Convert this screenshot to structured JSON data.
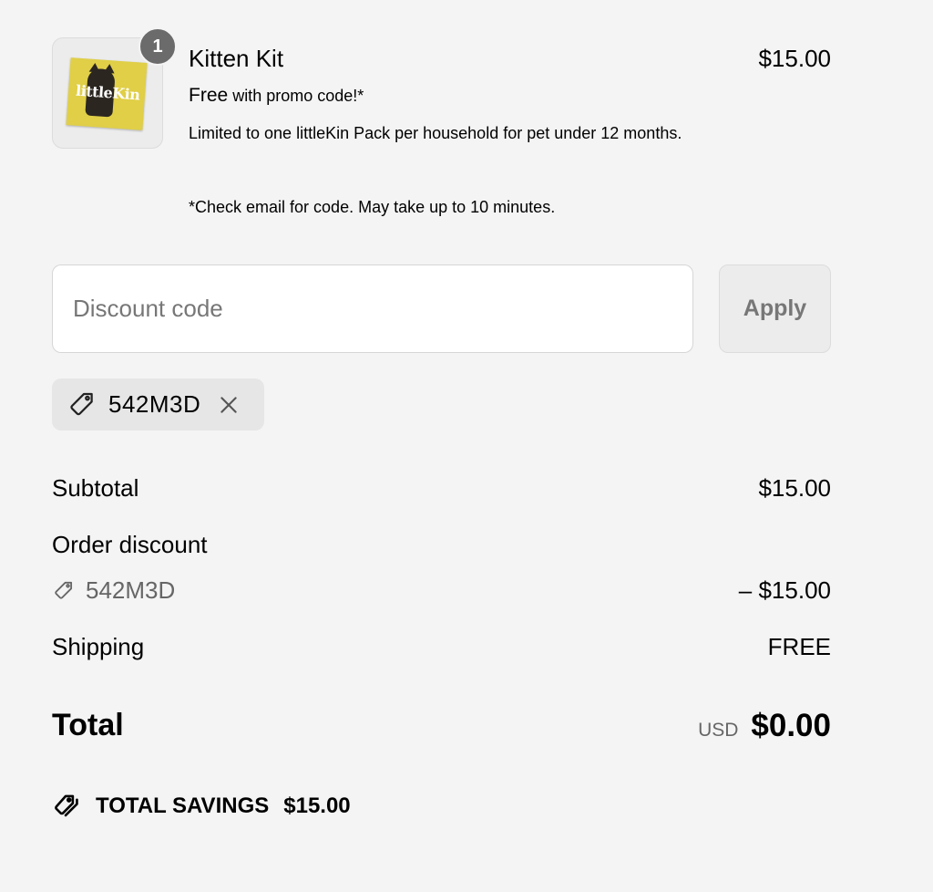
{
  "product": {
    "quantity": "1",
    "title": "Kitten Kit",
    "price": "$15.00",
    "free_label": "Free",
    "free_suffix": " with promo code!*",
    "note_line1": "Limited to one littleKin Pack per household for pet under 12 months.",
    "note_line2": "*Check email for code. May take up to 10 minutes.",
    "image": {
      "brand": "littleKin",
      "color": "#e0cf47"
    }
  },
  "discount": {
    "placeholder": "Discount code",
    "apply_label": "Apply",
    "applied_code": "542M3D"
  },
  "summary": {
    "subtotal_label": "Subtotal",
    "subtotal_value": "$15.00",
    "order_discount_label": "Order discount",
    "order_discount_code": "542M3D",
    "order_discount_value": "– $15.00",
    "shipping_label": "Shipping",
    "shipping_value": "FREE",
    "total_label": "Total",
    "total_currency": "USD",
    "total_value": "$0.00"
  },
  "savings": {
    "label": "TOTAL SAVINGS",
    "value": "$15.00"
  },
  "icons": {
    "tag": "tag-icon",
    "close": "close-icon",
    "tags": "tags-icon"
  }
}
